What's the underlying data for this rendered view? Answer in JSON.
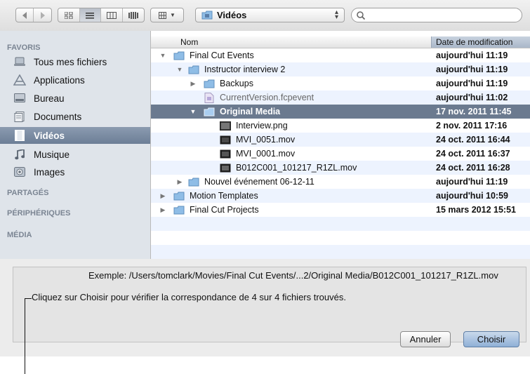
{
  "toolbar": {
    "path_label": "Vidéos",
    "search_placeholder": ""
  },
  "sidebar": {
    "favorites_title": "FAVORIS",
    "items": [
      {
        "label": "Tous mes fichiers",
        "icon": "all-files-icon"
      },
      {
        "label": "Applications",
        "icon": "applications-icon"
      },
      {
        "label": "Bureau",
        "icon": "desktop-icon"
      },
      {
        "label": "Documents",
        "icon": "documents-icon"
      },
      {
        "label": "Vidéos",
        "icon": "movies-icon"
      },
      {
        "label": "Musique",
        "icon": "music-icon"
      },
      {
        "label": "Images",
        "icon": "pictures-icon"
      }
    ],
    "shared_title": "PARTAGÉS",
    "devices_title": "PÉRIPHÉRIQUES",
    "media_title": "MÉDIA"
  },
  "columns": {
    "name": "Nom",
    "date": "Date de modification"
  },
  "files": [
    {
      "name": "Final Cut Events",
      "date": "aujourd'hui 11:19"
    },
    {
      "name": "Instructor interview 2",
      "date": "aujourd'hui 11:19"
    },
    {
      "name": "Backups",
      "date": "aujourd'hui 11:19"
    },
    {
      "name": "CurrentVersion.fcpevent",
      "date": "aujourd'hui 11:02"
    },
    {
      "name": "Original Media",
      "date": "17 nov. 2011 11:45"
    },
    {
      "name": "Interview.png",
      "date": "2 nov. 2011 17:16"
    },
    {
      "name": "MVI_0051.mov",
      "date": "24 oct. 2011 16:44"
    },
    {
      "name": "MVI_0001.mov",
      "date": "24 oct. 2011 16:37"
    },
    {
      "name": "B012C001_101217_R1ZL.mov",
      "date": "24 oct. 2011 16:28"
    },
    {
      "name": "Nouvel événement 06-12-11",
      "date": "aujourd'hui 11:19"
    },
    {
      "name": "Motion Templates",
      "date": "aujourd'hui 10:59"
    },
    {
      "name": "Final Cut Projects",
      "date": "15 mars 2012 15:51"
    }
  ],
  "bottom": {
    "example": "Exemple: /Users/tomclark/Movies/Final Cut Events/...2/Original Media/B012C001_101217_R1ZL.mov",
    "message": "Cliquez sur Choisir pour vérifier la correspondance de 4 sur 4 fichiers trouvés.",
    "cancel_label": "Annuler",
    "choose_label": "Choisir"
  },
  "colors": {
    "selection_row": "#6b7a8f",
    "sidebar_bg": "#dfe4ea",
    "folder": "#8fbde6",
    "default_button": "#8fb0d6"
  }
}
